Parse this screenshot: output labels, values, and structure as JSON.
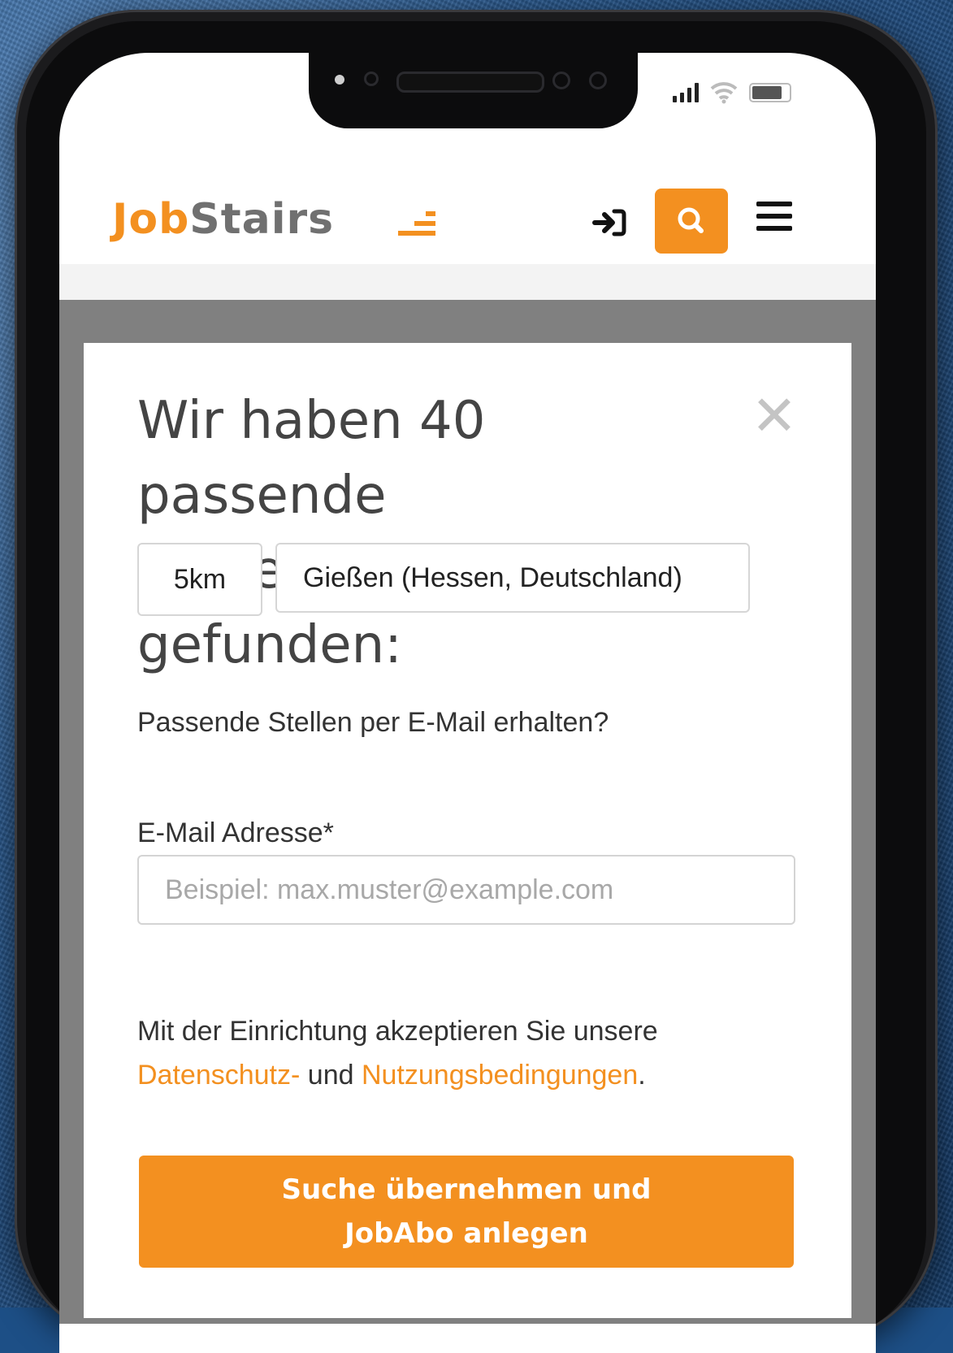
{
  "header": {
    "logo_job": "Job",
    "logo_stairs": "Stairs",
    "icons": [
      "login-icon",
      "search-icon",
      "menu-icon"
    ],
    "accent_color": "#f39020"
  },
  "modal": {
    "title": "Wir haben 40 passende Stellenangebote gefunden:",
    "close_icon": "close-icon",
    "radius_chip": "5km",
    "location_chip": "Gießen (Hessen, Deutschland)",
    "prompt": "Passende Stellen per E-Mail erhalten?",
    "email_label": "E-Mail Adresse*",
    "email_placeholder": "Beispiel: max.muster@example.com",
    "email_value": "",
    "legal_prefix": "Mit der Einrichtung akzeptieren Sie unsere",
    "legal_link1": "Datenschutz-",
    "legal_mid": "und",
    "legal_link2": "Nutzungsbedingungen",
    "legal_suffix": ".",
    "cta_line1": "Suche übernehmen und",
    "cta_line2": "JobAbo anlegen"
  }
}
